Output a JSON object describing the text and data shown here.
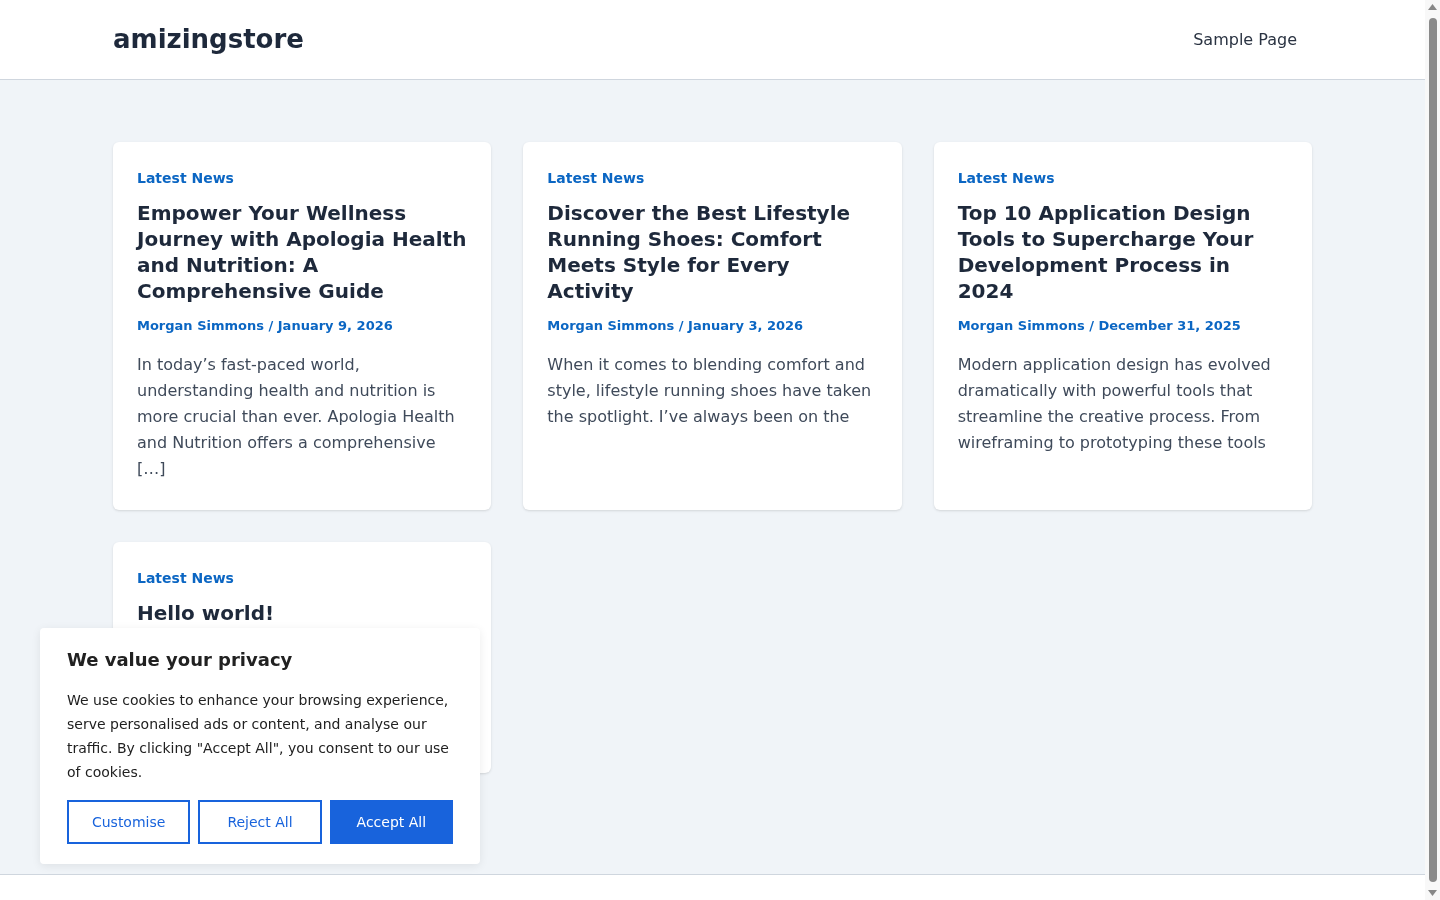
{
  "header": {
    "site_title": "amizingstore",
    "nav": [
      {
        "label": "Sample Page"
      }
    ]
  },
  "posts": [
    {
      "category": "Latest News",
      "title": "Empower Your Wellness Journey with Apologia Health and Nutrition: A Comprehensive Guide",
      "meta": "Morgan Simmons / January 9, 2026",
      "excerpt": "In today’s fast-paced world, understanding health and nutrition is more crucial than ever. Apologia Health and Nutrition offers a comprehensive […]"
    },
    {
      "category": "Latest News",
      "title": "Discover the Best Lifestyle Running Shoes: Comfort Meets Style for Every Activity",
      "meta": "Morgan Simmons / January 3, 2026",
      "excerpt": "When it comes to blending comfort and style, lifestyle running shoes have taken the spotlight. I’ve always been on the"
    },
    {
      "category": "Latest News",
      "title": "Top 10 Application Design Tools to Supercharge Your Development Process in 2024",
      "meta": "Morgan Simmons / December 31, 2025",
      "excerpt": "Modern application design has evolved dramatically with powerful tools that streamline the creative process. From wireframing to prototyping these tools"
    },
    {
      "category": "Latest News",
      "title": "Hello world!"
    }
  ],
  "cookie_banner": {
    "title": "We value your privacy",
    "text": "We use cookies to enhance your browsing experience, serve personalised ads or content, and analyse our traffic. By clicking \"Accept All\", you consent to our use of cookies.",
    "buttons": [
      {
        "label": "Customise",
        "kind": "outline"
      },
      {
        "label": "Reject All",
        "kind": "outline"
      },
      {
        "label": "Accept All",
        "kind": "primary"
      }
    ]
  }
}
